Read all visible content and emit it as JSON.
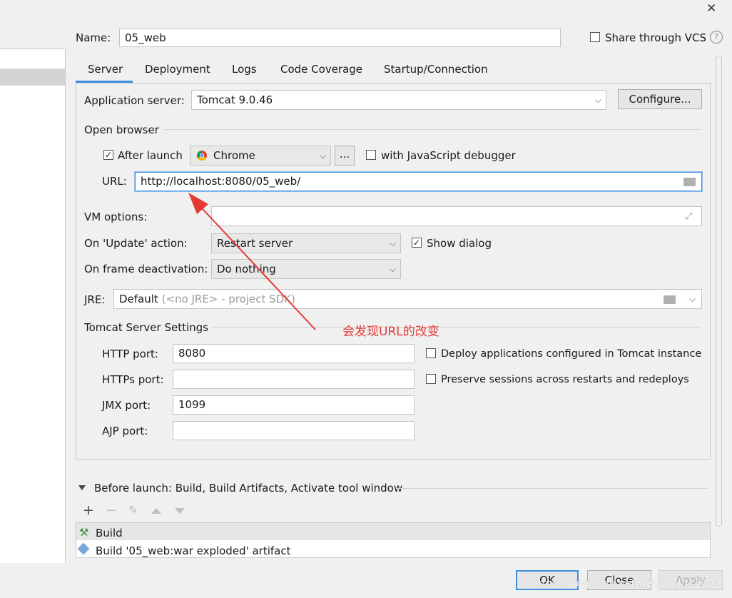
{
  "window": {
    "close_glyph": "✕"
  },
  "name_row": {
    "label": "Name:",
    "value": "05_web",
    "share_label": "Share through VCS",
    "help_glyph": "?"
  },
  "tabs": [
    {
      "label": "Server"
    },
    {
      "label": "Deployment"
    },
    {
      "label": "Logs"
    },
    {
      "label": "Code Coverage"
    },
    {
      "label": "Startup/Connection"
    }
  ],
  "server": {
    "app_server_label": "Application server:",
    "app_server_value": "Tomcat 9.0.46",
    "configure_label": "Configure...",
    "open_browser_label": "Open browser",
    "after_launch_label": "After launch",
    "browser_value": "Chrome",
    "browse_button": "...",
    "js_debugger_label": "with JavaScript debugger",
    "url_label": "URL:",
    "url_value": "http://localhost:8080/05_web/",
    "vm_options_label": "VM options:",
    "vm_options_value": "",
    "on_update_label": "On 'Update' action:",
    "on_update_value": "Restart server",
    "show_dialog_label": "Show dialog",
    "on_frame_label": "On frame deactivation:",
    "on_frame_value": "Do nothing",
    "jre_label": "JRE:",
    "jre_value": "Default",
    "jre_hint": "(<no JRE> - project SDK)",
    "tomcat_settings_label": "Tomcat Server Settings",
    "http_port_label": "HTTP port:",
    "http_port_value": "8080",
    "https_port_label": "HTTPs port:",
    "https_port_value": "",
    "jmx_port_label": "JMX port:",
    "jmx_port_value": "1099",
    "ajp_port_label": "AJP port:",
    "ajp_port_value": "",
    "deploy_label": "Deploy applications configured in Tomcat instance",
    "preserve_label": "Preserve sessions across restarts and redeploys"
  },
  "annotation": {
    "text": "会发现URL的改变",
    "color": "#e53935"
  },
  "before_launch": {
    "title": "Before launch: Build, Build Artifacts, Activate tool window",
    "items": [
      {
        "label": "Build"
      },
      {
        "label": "Build '05_web:war exploded' artifact"
      }
    ]
  },
  "footer": {
    "ok": "OK",
    "close": "Close",
    "apply": "Apply"
  },
  "watermark": "https://blog.csdn.net/weixin_45150029",
  "colors": {
    "accent": "#3d8ee0",
    "chrome": "#4285f4"
  }
}
